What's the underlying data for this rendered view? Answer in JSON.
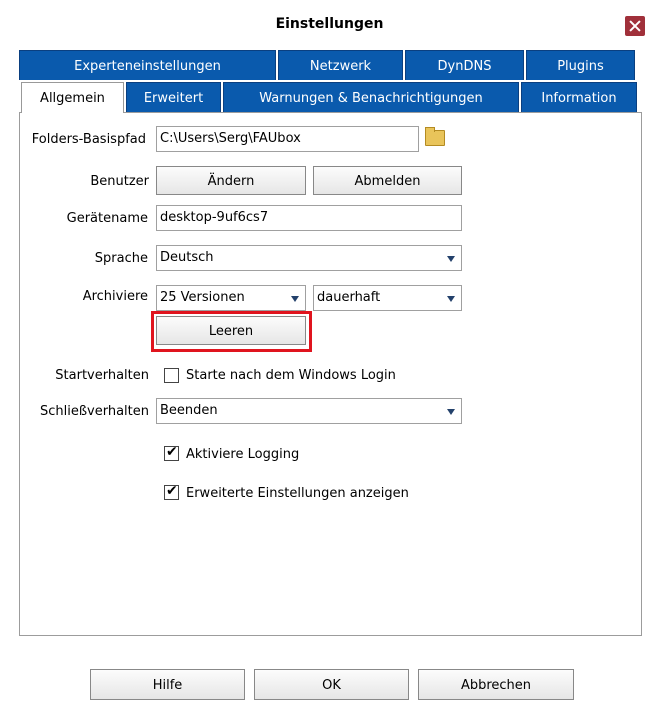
{
  "window": {
    "title": "Einstellungen"
  },
  "tabs": {
    "row1": [
      "Experteneinstellungen",
      "Netzwerk",
      "DynDNS",
      "Plugins"
    ],
    "row2": [
      "Allgemein",
      "Erweitert",
      "Warnungen & Benachrichtigungen",
      "Information"
    ],
    "active": "Allgemein"
  },
  "form": {
    "folder_label": "Folders-Basispfad",
    "folder_value": "C:\\Users\\Serg\\FAUbox",
    "user_label": "Benutzer",
    "change_button": "Ändern",
    "logout_button": "Abmelden",
    "device_label": "Gerätename",
    "device_value": "desktop-9uf6cs7",
    "language_label": "Sprache",
    "language_value": "Deutsch",
    "archive_label": "Archiviere",
    "archive_versions": "25 Versionen",
    "archive_duration": "dauerhaft",
    "clear_button": "Leeren",
    "startup_label": "Startverhalten",
    "startup_checkbox": "Starte nach dem Windows Login",
    "startup_checked": false,
    "close_label": "Schließverhalten",
    "close_value": "Beenden",
    "logging_checkbox": "Aktiviere Logging",
    "logging_checked": true,
    "advanced_checkbox": "Erweiterte Einstellungen anzeigen",
    "advanced_checked": true
  },
  "footer": {
    "help_button": "Hilfe",
    "ok_button": "OK",
    "cancel_button": "Abbrechen"
  },
  "colors": {
    "tab_blue": "#0a5aad",
    "highlight_red": "#e0141e",
    "close_button": "#a0303a"
  }
}
